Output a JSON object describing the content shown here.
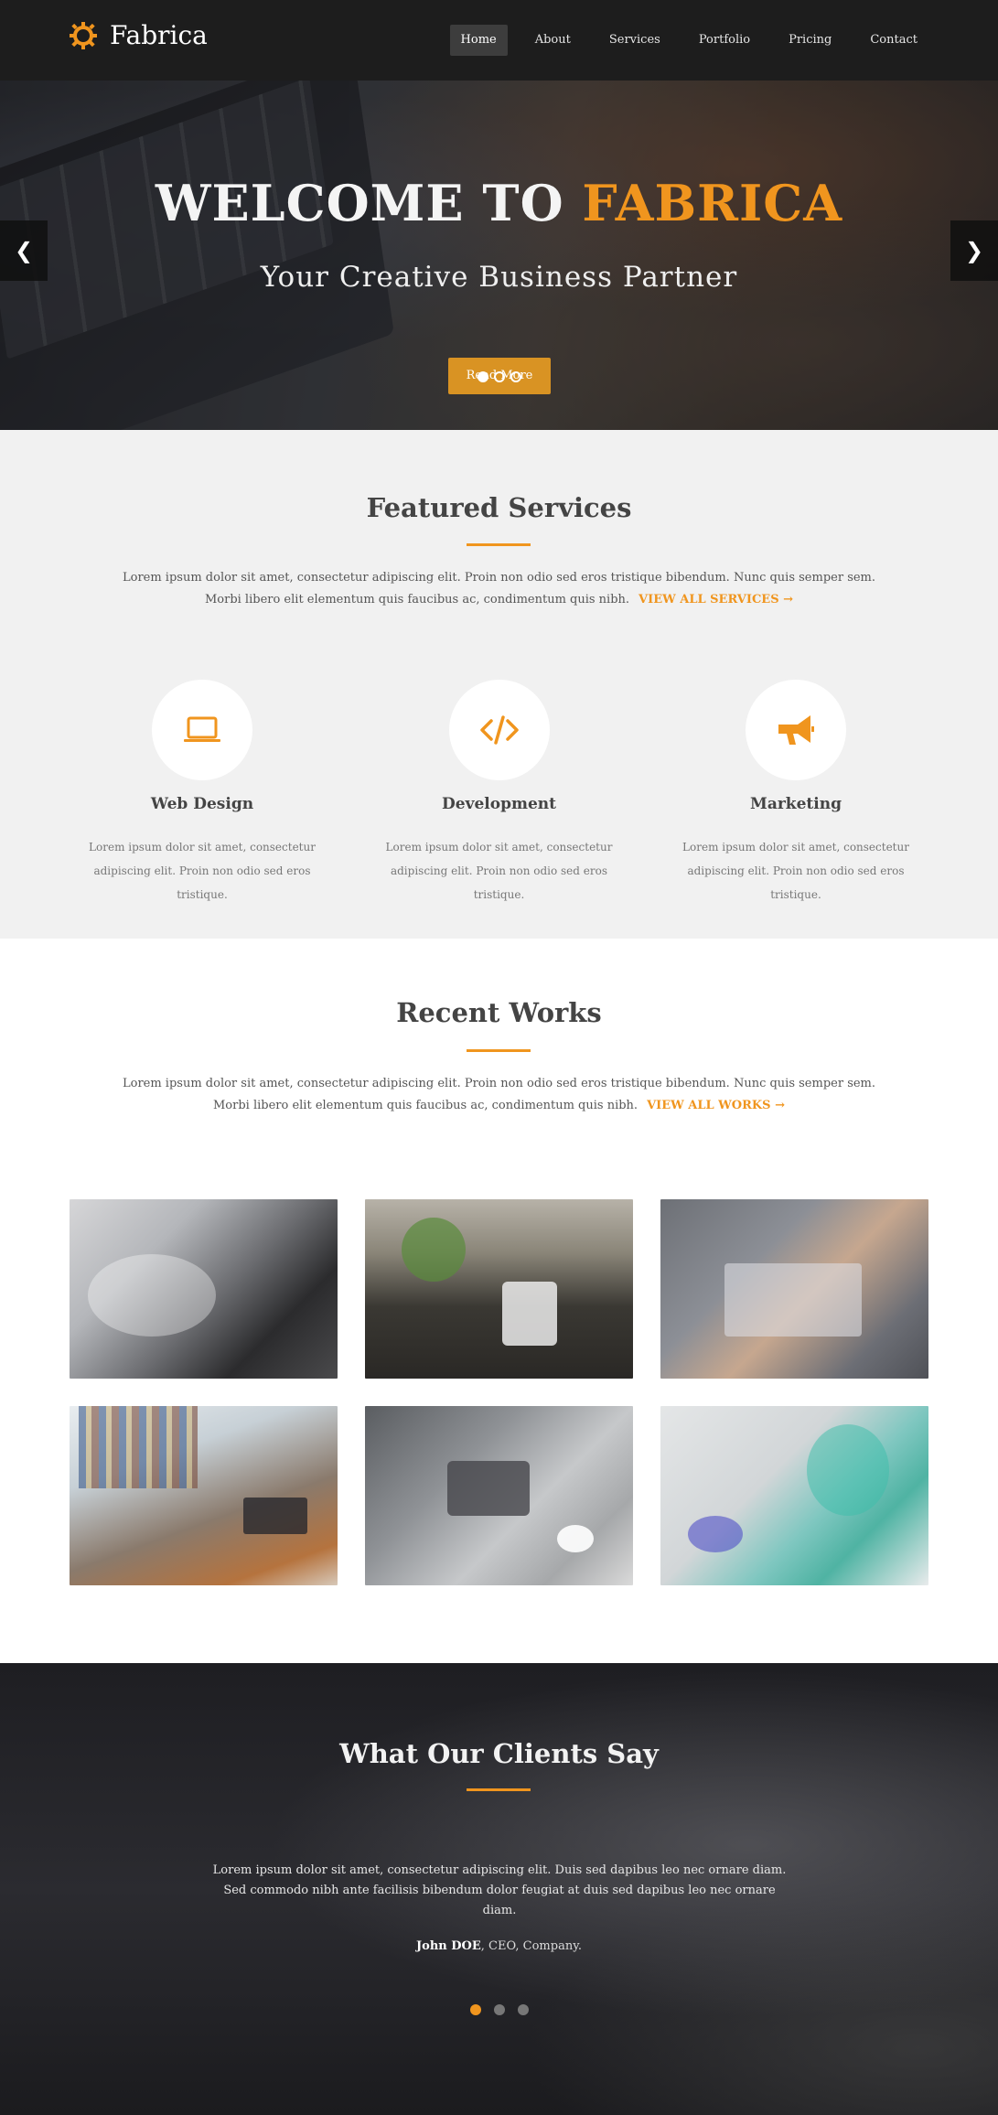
{
  "brand": {
    "name": "Fabrica",
    "accent": "#f0951e"
  },
  "nav": [
    {
      "label": "Home",
      "active": true
    },
    {
      "label": "About"
    },
    {
      "label": "Services"
    },
    {
      "label": "Portfolio"
    },
    {
      "label": "Pricing"
    },
    {
      "label": "Contact"
    }
  ],
  "hero": {
    "title_prefix": "WELCOME TO ",
    "title_accent": "FABRICA",
    "subtitle": "Your Creative Business Partner",
    "button": "Read More",
    "prev_icon": "chevron-left-icon",
    "next_icon": "chevron-right-icon"
  },
  "featured": {
    "title": "Featured Services",
    "desc_line1": "Lorem ipsum dolor sit amet, consectetur adipiscing elit. Proin non odio sed eros tristique bibendum. Nunc quis semper sem.",
    "desc_line2": "Morbi libero elit elementum quis faucibus ac, condimentum quis nibh.",
    "link": "VIEW ALL SERVICES →",
    "services": [
      {
        "icon": "laptop-icon",
        "title": "Web Design",
        "text": "Lorem ipsum dolor sit amet, consectetur adipiscing elit. Proin non odio sed eros tristique."
      },
      {
        "icon": "code-icon",
        "title": "Development",
        "text": "Lorem ipsum dolor sit amet, consectetur adipiscing elit. Proin non odio sed eros tristique."
      },
      {
        "icon": "megaphone-icon",
        "title": "Marketing",
        "text": "Lorem ipsum dolor sit amet, consectetur adipiscing elit. Proin non odio sed eros tristique."
      }
    ]
  },
  "works": {
    "title": "Recent Works",
    "desc_line1": "Lorem ipsum dolor sit amet, consectetur adipiscing elit. Proin non odio sed eros tristique bibendum. Nunc quis semper sem.",
    "desc_line2": "Morbi libero elit elementum quis faucibus ac, condimentum quis nibh.",
    "link": "VIEW ALL WORKS →"
  },
  "clients": {
    "title": "What Our Clients Say",
    "quote": "Lorem ipsum dolor sit amet, consectetur adipiscing elit. Duis sed dapibus leo nec ornare diam. Sed commodo nibh ante facilisis bibendum dolor feugiat at duis sed dapibus leo nec ornare diam.",
    "author_name": "John DOE",
    "author_role": ", CEO, Company."
  }
}
